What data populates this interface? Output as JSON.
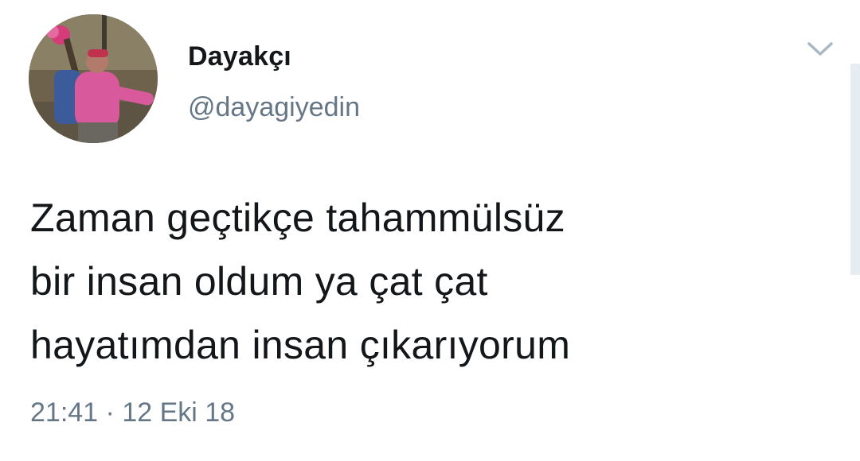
{
  "user": {
    "display_name": "Dayakçı",
    "handle": "@dayagiyedin",
    "avatar_icon": "profile-photo"
  },
  "tweet": {
    "lines": [
      "Zaman geçtikçe tahammülsüz",
      "bir insan oldum ya çat çat",
      "hayatımdan insan çıkarıyorum"
    ],
    "time": "21:41",
    "separator": "·",
    "date": "12 Eki 18"
  },
  "menu": {
    "caret_icon": "chevron-down-icon"
  },
  "colors": {
    "text": "#14171a",
    "secondary": "#657786",
    "caret": "#aab8c2",
    "scrollbar": "#e6ecf0"
  }
}
